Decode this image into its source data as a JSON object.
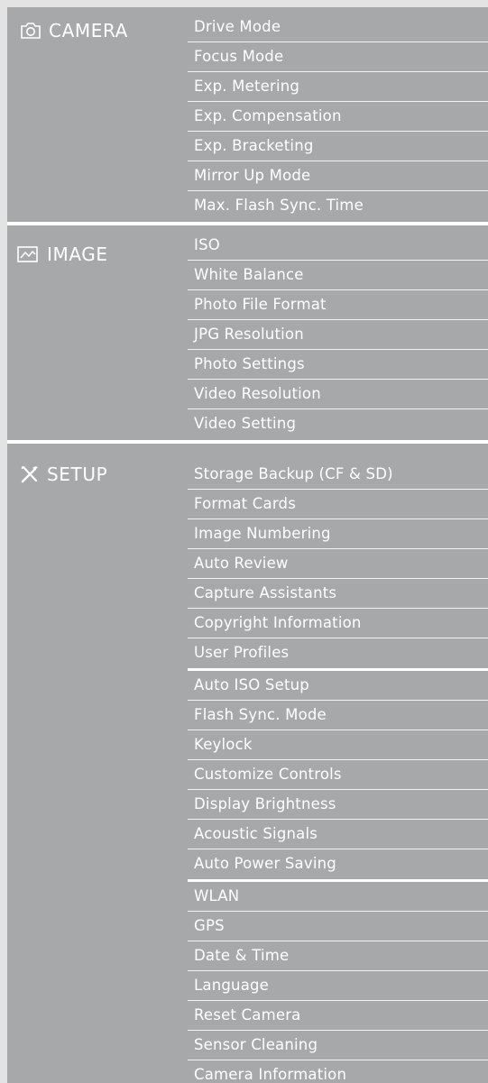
{
  "menu": {
    "camera": {
      "title": "CAMERA",
      "icon": "camera-icon",
      "items": [
        "Drive Mode",
        "Focus Mode",
        "Exp. Metering",
        "Exp. Compensation",
        "Exp. Bracketing",
        "Mirror Up Mode",
        "Max. Flash Sync. Time"
      ]
    },
    "image": {
      "title": "IMAGE",
      "icon": "image-icon",
      "items": [
        "ISO",
        "White Balance",
        "Photo File Format",
        "JPG Resolution",
        "Photo Settings",
        "Video Resolution",
        "Video Setting"
      ]
    },
    "setup": {
      "title": "SETUP",
      "icon": "tools-icon",
      "items": [
        "Storage Backup (CF & SD)",
        "Format Cards",
        "Image Numbering",
        "Auto Review",
        "Capture Assistants",
        "Copyright Information",
        "User Profiles",
        "Auto ISO Setup",
        "Flash Sync. Mode",
        "Keylock",
        "Customize Controls",
        "Display Brightness",
        "Acoustic Signals",
        "Auto Power Saving",
        "WLAN",
        "GPS",
        "Date & Time",
        "Language",
        "Reset Camera",
        "Sensor Cleaning",
        "Camera Information"
      ]
    }
  },
  "colors": {
    "background": "#a7a8aa",
    "text": "#ffffff",
    "frame": "#e3e3e3"
  }
}
